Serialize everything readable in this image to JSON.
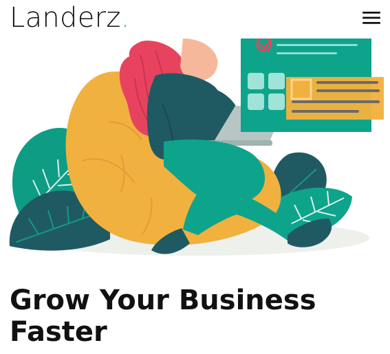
{
  "header": {
    "logo_text": "Landerz",
    "logo_dot": ".",
    "menu_icon": "hamburger-icon"
  },
  "hero": {
    "headline": "Grow Your Business Faster"
  },
  "colors": {
    "brand_accent": "#18b5aa",
    "text": "#111111",
    "illustration_yellow": "#f1b13f",
    "illustration_teal": "#0ea48b",
    "illustration_dark_teal": "#1f5a63",
    "illustration_pink": "#e7435f"
  }
}
